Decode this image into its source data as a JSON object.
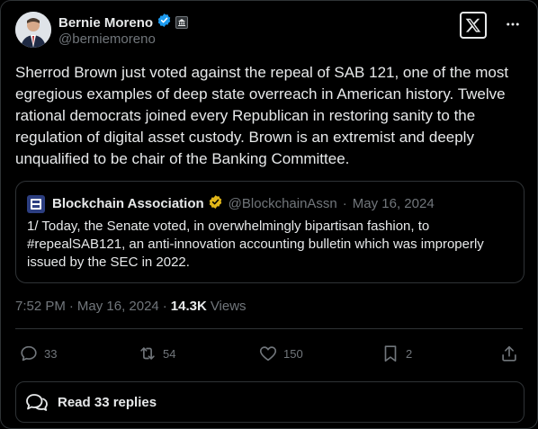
{
  "author": {
    "display_name": "Bernie Moreno",
    "handle": "@berniemoreno"
  },
  "tweet": {
    "text": "Sherrod Brown just voted against the repeal of SAB 121, one of the most egregious examples of deep state overreach in American history. Twelve rational democrats joined every Republican in restoring sanity to the regulation of digital asset custody. Brown is an extremist and deeply unqualified to be chair of the Banking Committee."
  },
  "quote": {
    "name": "Blockchain Association",
    "handle": "@BlockchainAssn",
    "separator": "·",
    "date": "May 16, 2024",
    "text": "1/ Today, the Senate voted, in overwhelmingly bipartisan fashion, to #repealSAB121, an anti-innovation accounting bulletin which was improperly issued by the SEC in 2022."
  },
  "meta": {
    "time": "7:52 PM",
    "sep1": "·",
    "date": "May 16, 2024",
    "sep2": "·",
    "views_count": "14.3K",
    "views_label": "Views"
  },
  "actions": {
    "replies": "33",
    "reposts": "54",
    "likes": "150",
    "bookmarks": "2"
  },
  "read_replies_label": "Read 33 replies",
  "colors": {
    "background": "#000000",
    "text": "#e7e9ea",
    "muted": "#71767b",
    "border": "#2f3336",
    "verified_blue": "#1d9bf0",
    "verified_gold": "#e2b719"
  },
  "icons": [
    "verified-blue-icon",
    "government-badge-icon",
    "x-logo-icon",
    "more-icon",
    "verified-gold-icon",
    "reply-icon",
    "repost-icon",
    "like-icon",
    "bookmark-icon",
    "share-icon",
    "replies-bubble-icon"
  ]
}
